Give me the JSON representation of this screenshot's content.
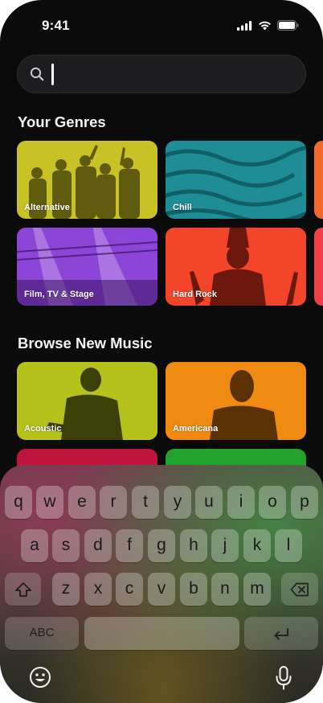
{
  "status": {
    "time": "9:41"
  },
  "search": {
    "value": "",
    "placeholder": ""
  },
  "genres": {
    "title": "Your Genres",
    "tiles": [
      "Alternative",
      "Chill",
      "Film, TV & Stage",
      "Hard Rock"
    ]
  },
  "browse": {
    "title": "Browse New Music",
    "tiles": [
      "Acoustic",
      "Americana"
    ]
  },
  "tile_colors": {
    "alternative": "#c9c227",
    "chill": "#1e8d96",
    "film": "#8c45d6",
    "hard_rock": "#f2452a",
    "acoustic": "#b6c21c",
    "americana": "#ef8a12",
    "row3_left": "#c0143c",
    "row3_right": "#21a32c",
    "edge_orange": "#f26a2a",
    "edge_red": "#f23d4a"
  },
  "keyboard": {
    "row1": [
      "q",
      "w",
      "e",
      "r",
      "t",
      "y",
      "u",
      "i",
      "o",
      "p"
    ],
    "row2": [
      "a",
      "s",
      "d",
      "f",
      "g",
      "h",
      "j",
      "k",
      "l"
    ],
    "row3": [
      "z",
      "x",
      "c",
      "v",
      "b",
      "n",
      "m"
    ],
    "abc_label": "ABC",
    "icons": {
      "shift": "shift-icon",
      "delete": "delete-icon",
      "return": "return-icon",
      "emoji": "emoji-icon",
      "dictation": "microphone-icon"
    }
  }
}
